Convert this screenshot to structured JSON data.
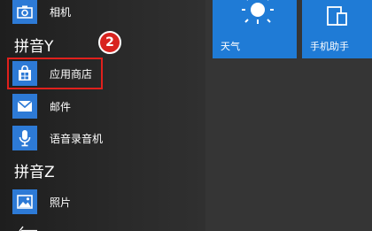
{
  "apps": {
    "camera": {
      "label": "相机",
      "icon": "camera-icon"
    },
    "store": {
      "label": "应用商店",
      "icon": "store-icon"
    },
    "mail": {
      "label": "邮件",
      "icon": "mail-icon"
    },
    "recorder": {
      "label": "语音录音机",
      "icon": "microphone-icon"
    },
    "photos": {
      "label": "照片",
      "icon": "photo-icon"
    }
  },
  "groups": {
    "y": "拼音Y",
    "z": "拼音Z"
  },
  "annotation": {
    "step": "2"
  },
  "tiles": {
    "weather": {
      "label": "天气",
      "icon": "sun-icon"
    },
    "phone": {
      "label": "手机助手",
      "icon": "phone-tablet-icon"
    }
  },
  "colors": {
    "tile_blue": "#1f7bd6",
    "icon_blue": "#2d7ad6",
    "highlight_red": "#e0201c"
  }
}
